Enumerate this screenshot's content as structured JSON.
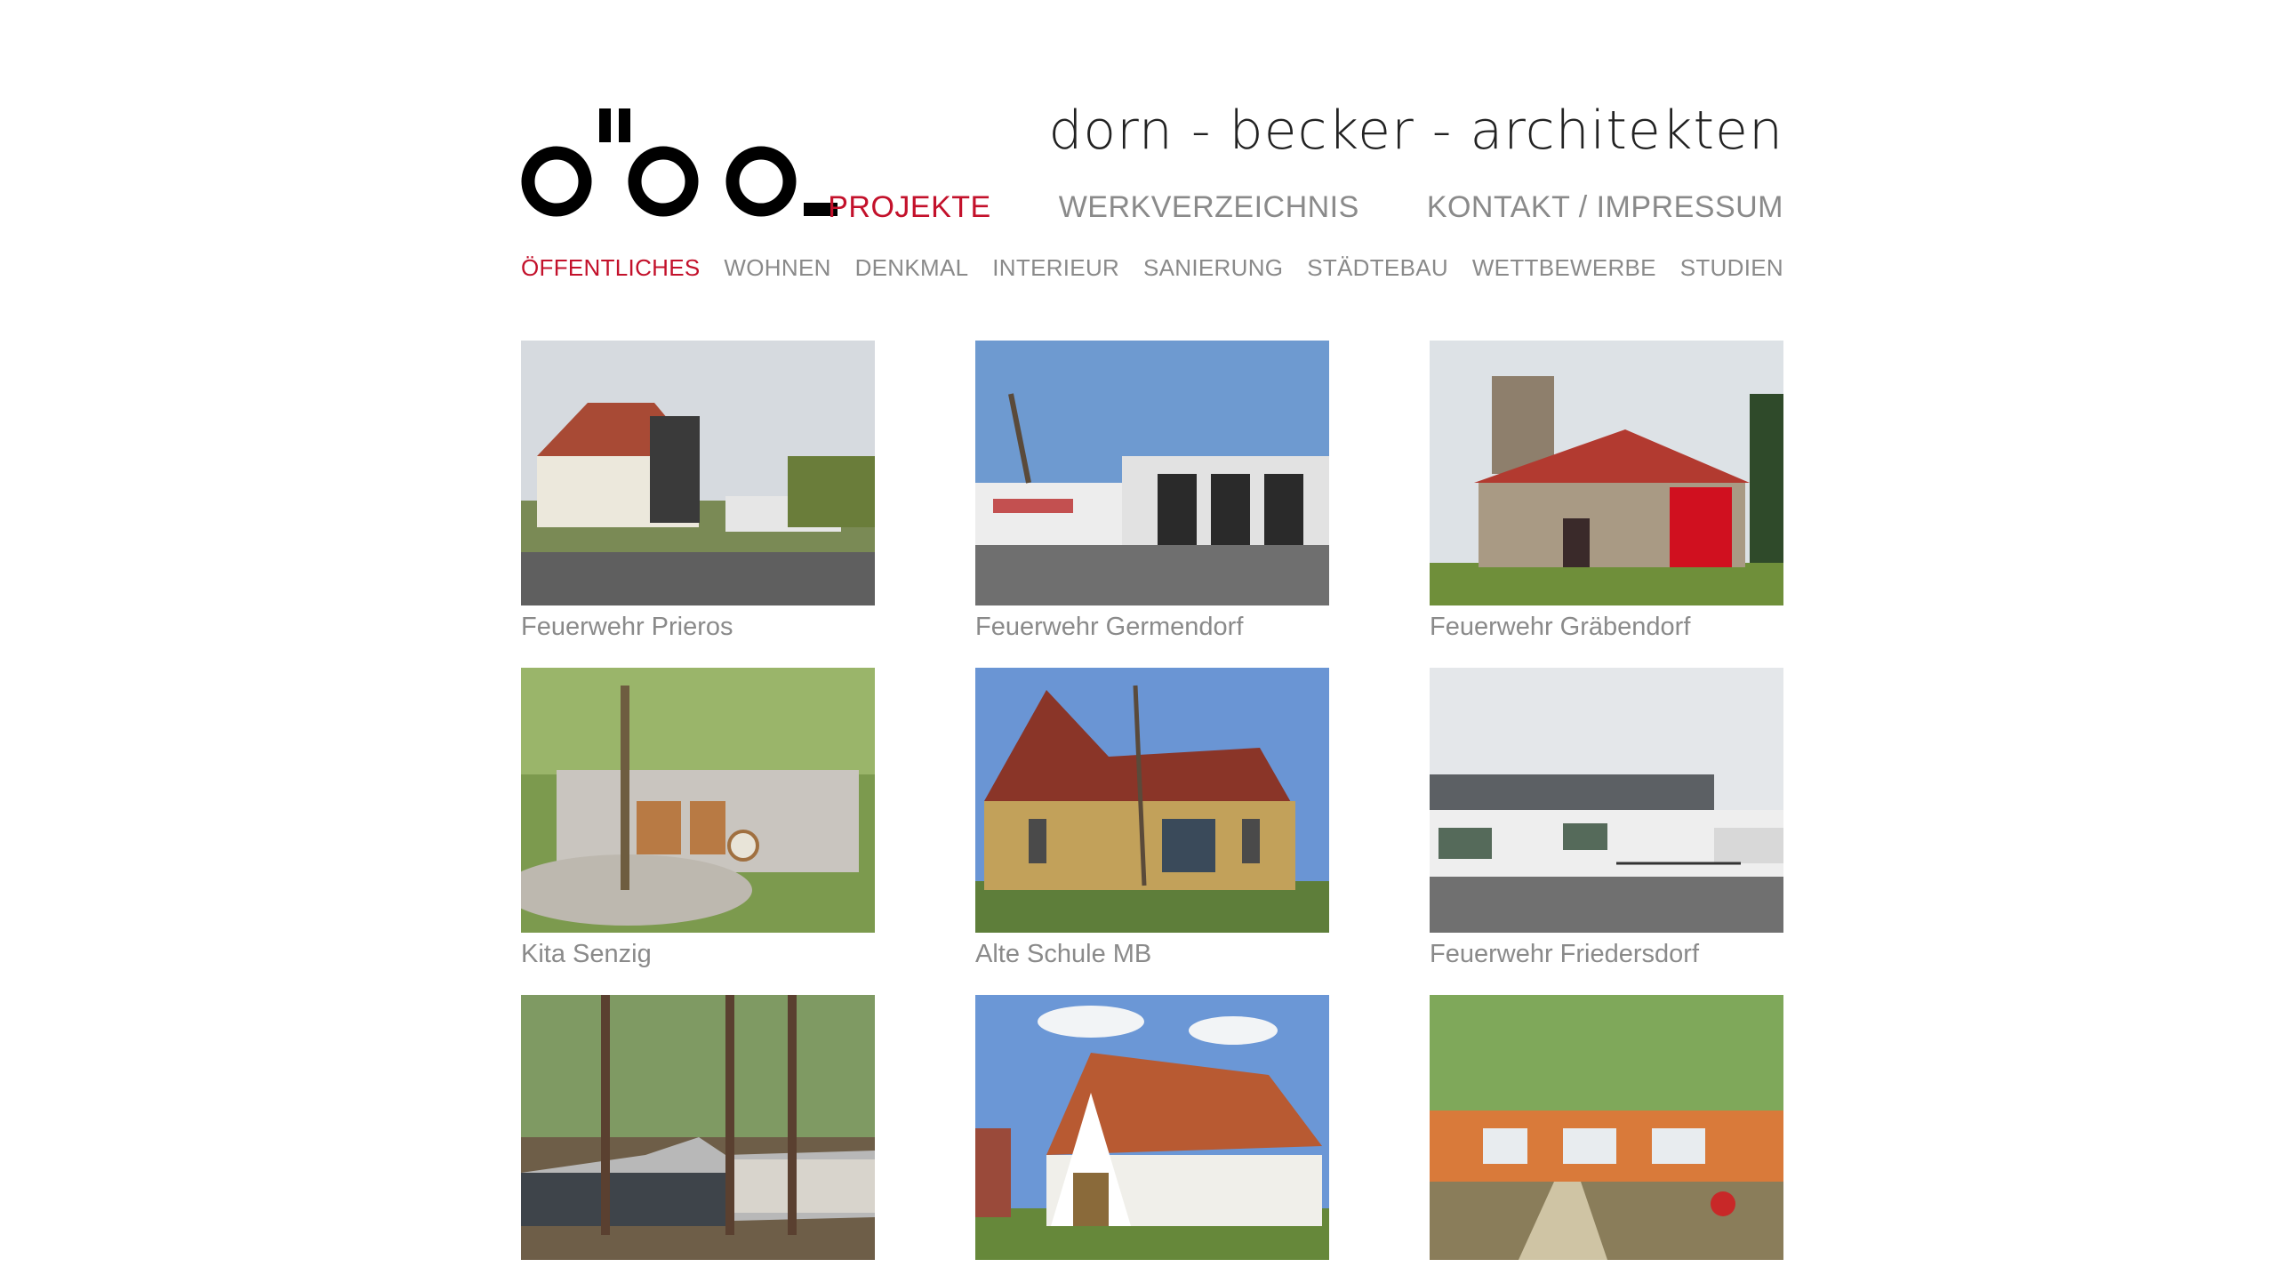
{
  "brand": {
    "name": "dorn - becker - architekten",
    "logo_icon": "dba-logo-icon"
  },
  "main_nav": [
    {
      "label": "PROJEKTE",
      "active": true
    },
    {
      "label": "WERKVERZEICHNIS",
      "active": false
    },
    {
      "label": "KONTAKT / IMPRESSUM",
      "active": false
    }
  ],
  "sub_nav": [
    {
      "label": "ÖFFENTLICHES",
      "active": true
    },
    {
      "label": "WOHNEN",
      "active": false
    },
    {
      "label": "DENKMAL",
      "active": false
    },
    {
      "label": "INTERIEUR",
      "active": false
    },
    {
      "label": "SANIERUNG",
      "active": false
    },
    {
      "label": "STÄDTEBAU",
      "active": false
    },
    {
      "label": "WETTBEWERBE",
      "active": false
    },
    {
      "label": "STUDIEN",
      "active": false
    }
  ],
  "projects": [
    {
      "caption": "Feuerwehr Prieros"
    },
    {
      "caption": "Feuerwehr Germendorf"
    },
    {
      "caption": "Feuerwehr Gräbendorf"
    },
    {
      "caption": "Kita Senzig"
    },
    {
      "caption": "Alte Schule MB"
    },
    {
      "caption": "Feuerwehr Friedersdorf"
    },
    {
      "caption": ""
    },
    {
      "caption": ""
    },
    {
      "caption": ""
    }
  ],
  "colors": {
    "accent": "#c3112b",
    "nav_text": "#8a8a8a",
    "brand_text": "#222222"
  }
}
